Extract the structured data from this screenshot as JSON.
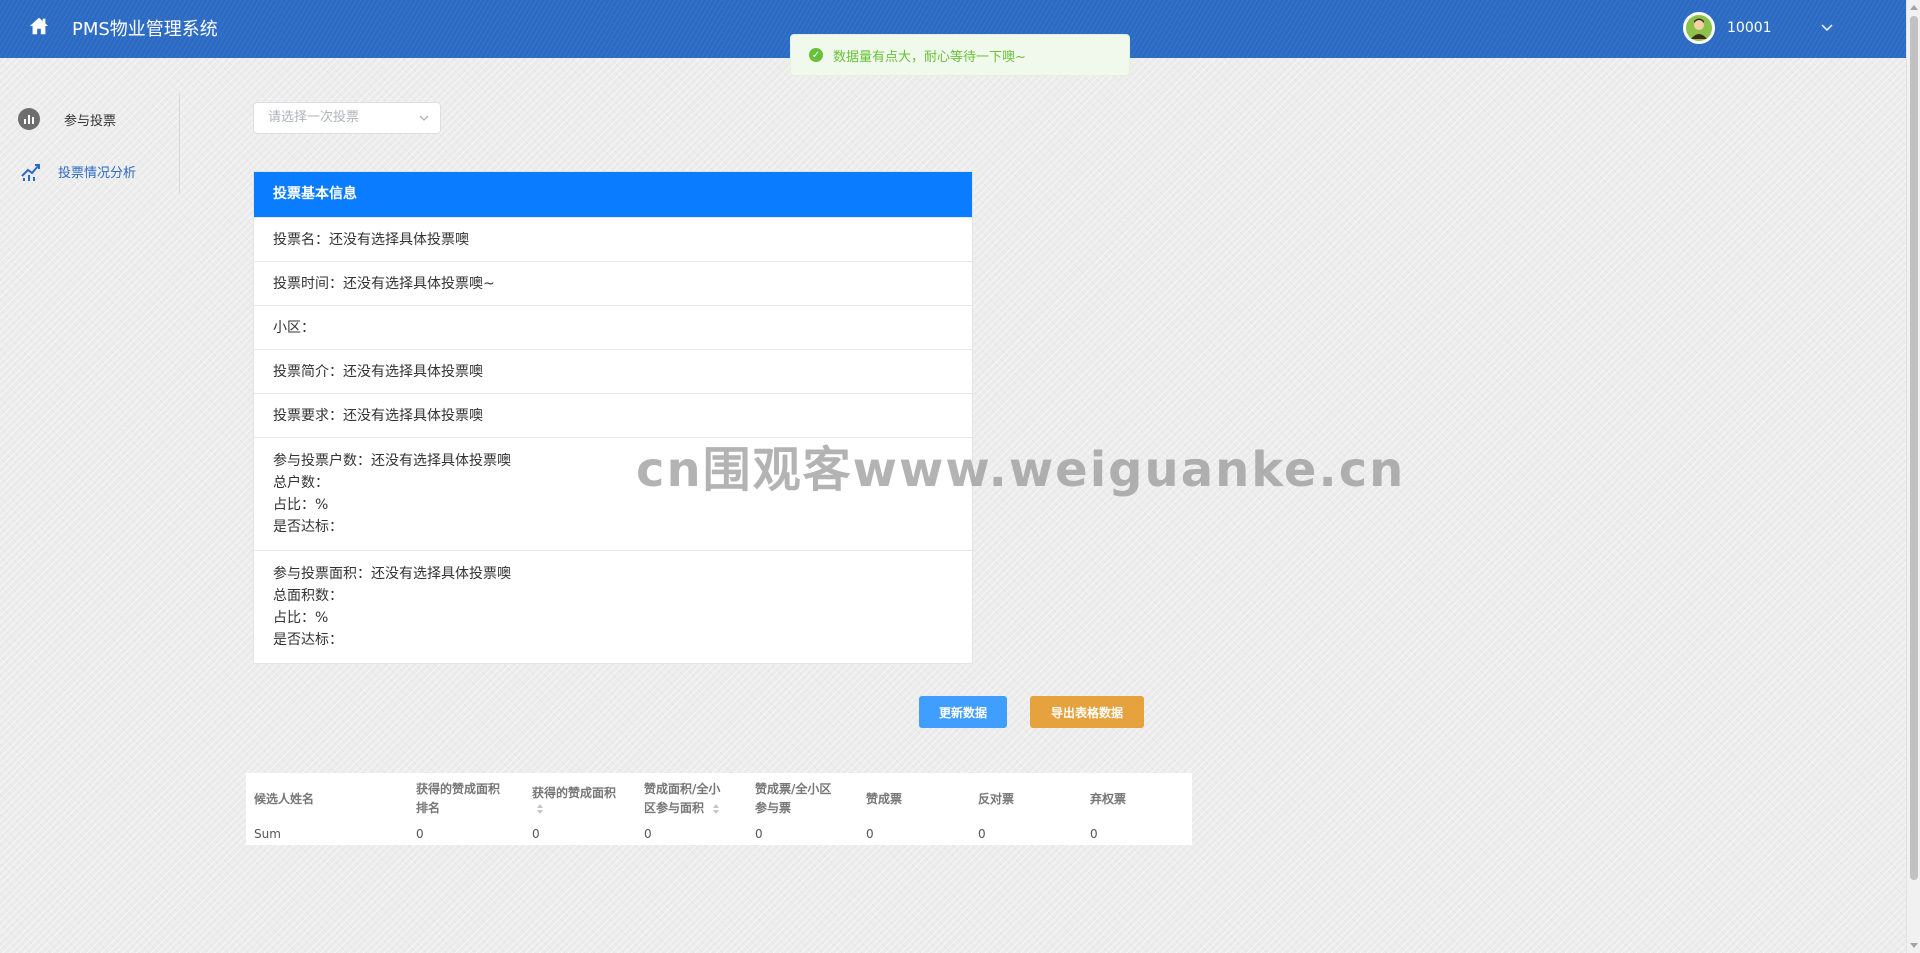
{
  "header": {
    "title": "PMS物业管理系统",
    "user_id": "10001"
  },
  "toast": {
    "message": "数据量有点大，耐心等待一下噢~",
    "color": "#67c23a"
  },
  "sidebar": {
    "items": [
      {
        "label": "参与投票",
        "icon": "bar-chart-icon",
        "active": false
      },
      {
        "label": "投票情况分析",
        "icon": "trend-icon",
        "active": true
      }
    ]
  },
  "select": {
    "placeholder": "请选择一次投票"
  },
  "info": {
    "header": "投票基本信息",
    "rows": [
      [
        "投票名：还没有选择具体投票噢"
      ],
      [
        "投票时间：还没有选择具体投票噢~"
      ],
      [
        "小区："
      ],
      [
        "投票简介：还没有选择具体投票噢"
      ],
      [
        "投票要求：还没有选择具体投票噢"
      ],
      [
        "参与投票户数：还没有选择具体投票噢",
        "总户数：",
        "占比：%",
        "是否达标："
      ],
      [
        "参与投票面积：还没有选择具体投票噢",
        "总面积数：",
        "占比：%",
        "是否达标："
      ]
    ]
  },
  "buttons": {
    "refresh": "更新数据",
    "export": "导出表格数据"
  },
  "table": {
    "columns": [
      {
        "lines": [
          "候选人姓名"
        ]
      },
      {
        "lines": [
          "获得的赞成面积",
          "排名"
        ]
      },
      {
        "lines": [
          "获得的赞成面积"
        ],
        "sortable": true
      },
      {
        "lines": [
          "赞成面积/全小",
          "区参与面积"
        ],
        "sortable": true
      },
      {
        "lines": [
          "赞成票/全小区",
          "参与票"
        ]
      },
      {
        "lines": [
          "赞成票"
        ]
      },
      {
        "lines": [
          "反对票"
        ]
      },
      {
        "lines": [
          "弃权票"
        ]
      }
    ],
    "rows": [
      [
        "Sum",
        "0",
        "0",
        "0",
        "0",
        "0",
        "0",
        "0"
      ]
    ]
  },
  "watermark": "cn围观客www.weiguanke.cn",
  "colors": {
    "header_bg": "#2c6bc4",
    "panel_header": "#0a7cff",
    "refresh_button": "#409eff",
    "export_button": "#e6a23c"
  }
}
